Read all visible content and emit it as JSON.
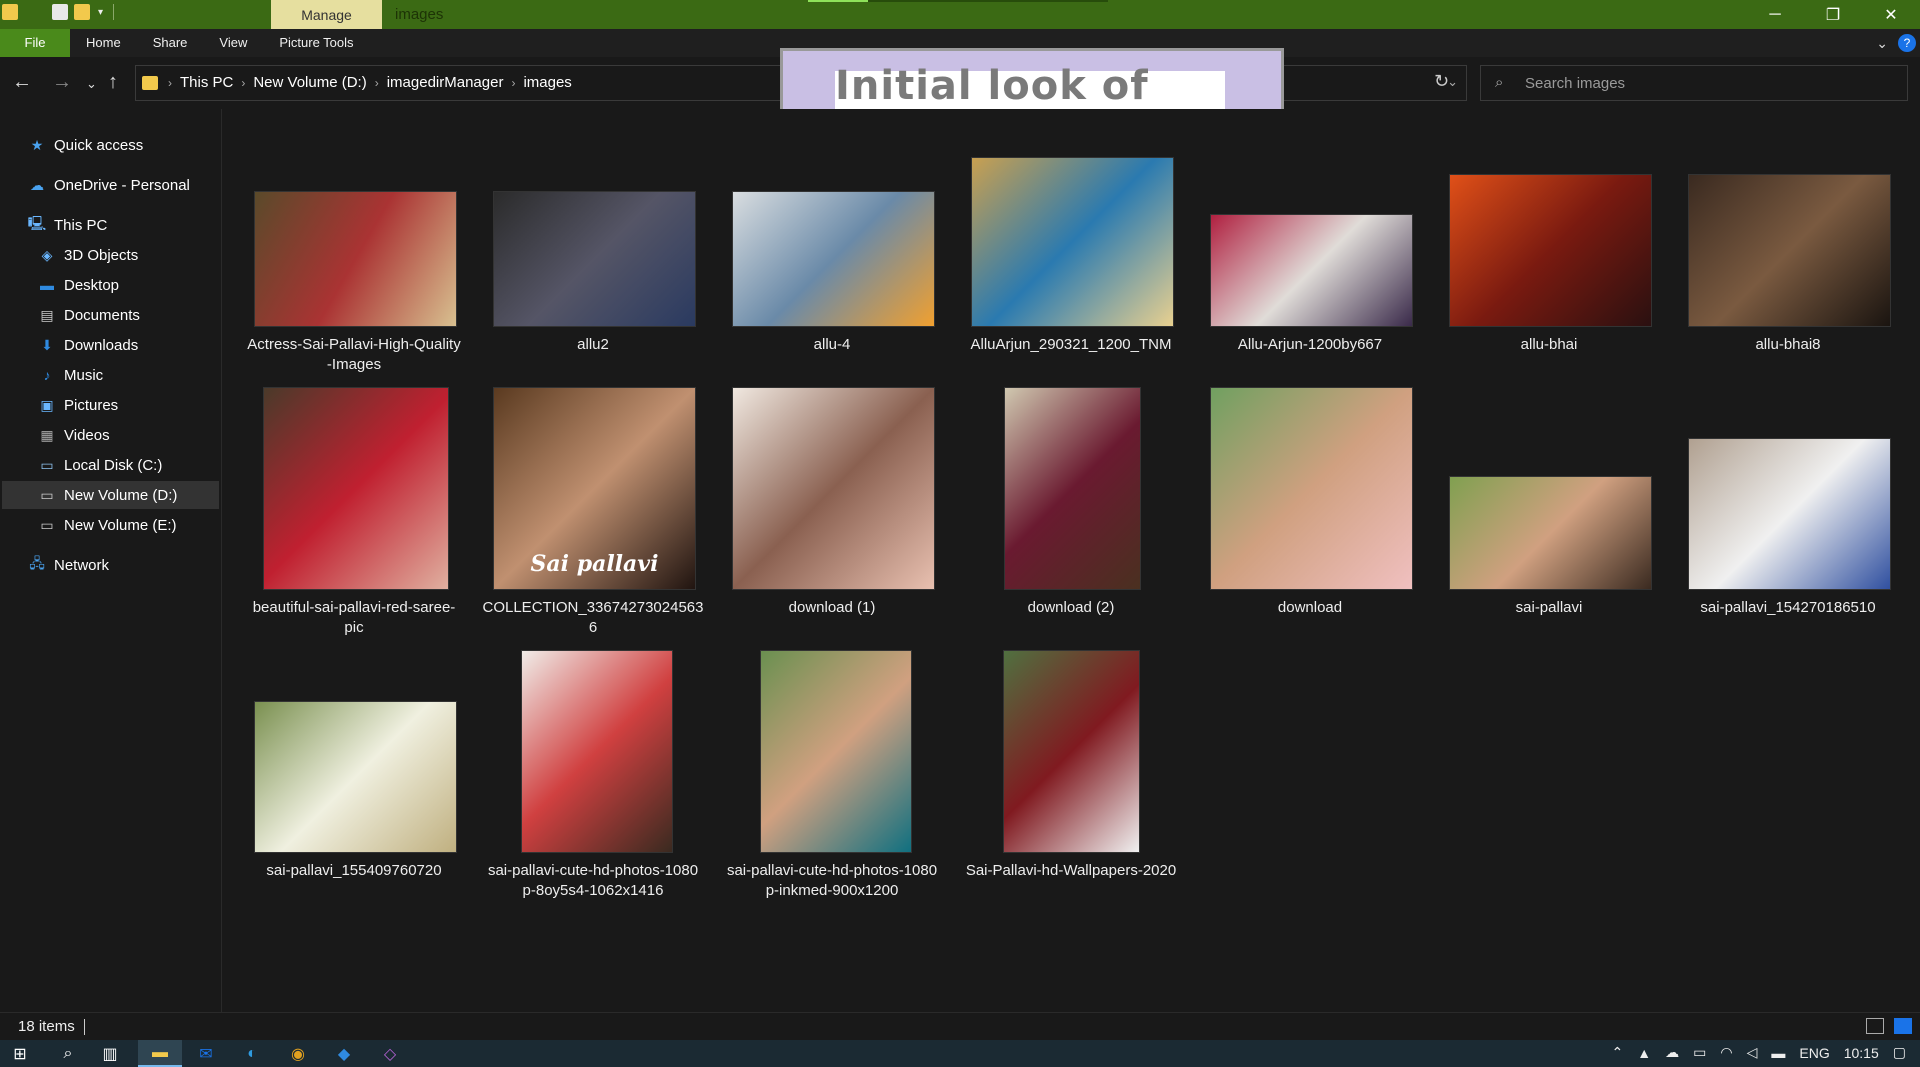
{
  "titlebar": {
    "manage_tab": "Manage",
    "title": "images",
    "controls": [
      "─",
      "❐",
      "✕"
    ]
  },
  "ribbon": {
    "tabs": [
      "File",
      "Home",
      "Share",
      "View",
      "Picture Tools"
    ]
  },
  "address": {
    "crumbs": [
      "This PC",
      "New Volume (D:)",
      "imagedirManager",
      "images"
    ],
    "search_placeholder": "Search images"
  },
  "overlay": {
    "text": "Initial look of dir"
  },
  "sidebar": {
    "items": [
      {
        "label": "Quick access",
        "icon": "star-icon"
      },
      {
        "label": "OneDrive - Personal",
        "icon": "cloud-icon"
      },
      {
        "label": "This PC",
        "icon": "computer-icon"
      },
      {
        "label": "3D Objects",
        "icon": "cube-icon"
      },
      {
        "label": "Desktop",
        "icon": "desktop-icon"
      },
      {
        "label": "Documents",
        "icon": "documents-icon"
      },
      {
        "label": "Downloads",
        "icon": "download-icon"
      },
      {
        "label": "Music",
        "icon": "music-icon"
      },
      {
        "label": "Pictures",
        "icon": "pictures-icon"
      },
      {
        "label": "Videos",
        "icon": "videos-icon"
      },
      {
        "label": "Local Disk (C:)",
        "icon": "drive-icon"
      },
      {
        "label": "New Volume (D:)",
        "icon": "drive-icon"
      },
      {
        "label": "New Volume (E:)",
        "icon": "drive-icon"
      },
      {
        "label": "Network",
        "icon": "network-icon"
      }
    ]
  },
  "files": [
    {
      "name": "Actress-Sai-Pallavi-High-Quality-Images",
      "line1": "Actress-Sai-Pallavi-High-Quality",
      "line2": "-Images"
    },
    {
      "name": "allu2",
      "line1": "allu2",
      "line2": ""
    },
    {
      "name": "allu-4",
      "line1": "allu-4",
      "line2": ""
    },
    {
      "name": "AlluArjun_290321_1200_TNM",
      "line1": "AlluArjun_290321_1200_TNM",
      "line2": ""
    },
    {
      "name": "Allu-Arjun-1200by667",
      "line1": "Allu-Arjun-1200by667",
      "line2": ""
    },
    {
      "name": "allu-bhai",
      "line1": "allu-bhai",
      "line2": ""
    },
    {
      "name": "allu-bhai8",
      "line1": "allu-bhai8",
      "line2": ""
    },
    {
      "name": "beautiful-sai-pallavi-red-saree-pic",
      "line1": "beautiful-sai-pallavi-red-saree-",
      "line2": "pic"
    },
    {
      "name": "COLLECTION_336742730245636",
      "line1": "COLLECTION_336742730245636",
      "line2": "",
      "thumb_text": "Sai pallavi"
    },
    {
      "name": "download (1)",
      "line1": "download (1)",
      "line2": ""
    },
    {
      "name": "download (2)",
      "line1": "download (2)",
      "line2": ""
    },
    {
      "name": "download",
      "line1": "download",
      "line2": ""
    },
    {
      "name": "sai-pallavi",
      "line1": "sai-pallavi",
      "line2": ""
    },
    {
      "name": "sai-pallavi_154270186510",
      "line1": "sai-pallavi_154270186510",
      "line2": ""
    },
    {
      "name": "sai-pallavi_155409760720",
      "line1": "sai-pallavi_155409760720",
      "line2": ""
    },
    {
      "name": "sai-pallavi-cute-hd-photos-1080p-8oy5s4-1062x1416",
      "line1": "sai-pallavi-cute-hd-photos-1080",
      "line2": "p-8oy5s4-1062x1416"
    },
    {
      "name": "sai-pallavi-cute-hd-photos-1080p-inkmed-900x1200",
      "line1": "sai-pallavi-cute-hd-photos-1080",
      "line2": "p-inkmed-900x1200"
    },
    {
      "name": "Sai-Pallavi-hd-Wallpapers-2020",
      "line1": "Sai-Pallavi-hd-Wallpapers-2020",
      "line2": ""
    }
  ],
  "status": {
    "count": "18 items"
  },
  "taskbar": {
    "lang": "ENG",
    "time": "10:15"
  }
}
